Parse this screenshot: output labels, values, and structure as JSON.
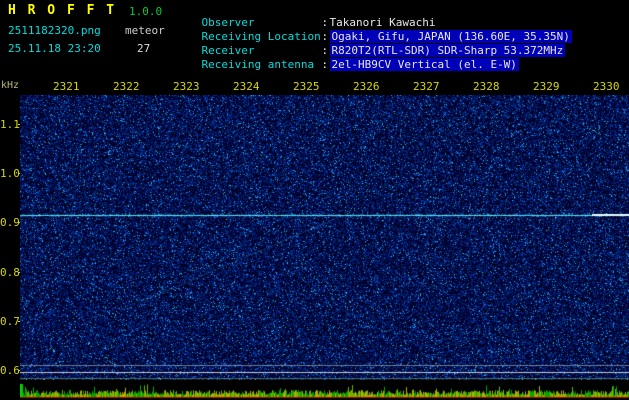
{
  "app": {
    "title": "H R O F F T",
    "version": "1.0.0",
    "filename": "2511182320.png",
    "mode": "meteor",
    "datetime": "25.11.18 23:20",
    "count": "27"
  },
  "info": {
    "colon": ":",
    "rows": [
      {
        "label": "Observer",
        "value": "Takanori Kawachi",
        "highlighted": false
      },
      {
        "label": "Receiving Location",
        "value": "Ogaki, Gifu, JAPAN (136.60E, 35.35N)",
        "highlighted": true
      },
      {
        "label": "Receiver",
        "value": "R820T2(RTL-SDR) SDR-Sharp 53.372MHz",
        "highlighted": true
      },
      {
        "label": "Receiving antenna",
        "value": "2el-HB9CV Vertical (el. E-W)",
        "highlighted": true
      }
    ]
  },
  "axes": {
    "y_unit": "kHz",
    "time_labels": [
      "2321",
      "2322",
      "2323",
      "2324",
      "2325",
      "2326",
      "2327",
      "2328",
      "2329",
      "2330"
    ],
    "freq_labels": [
      "1.1",
      "1.0",
      "0.9",
      "0.8",
      "0.7",
      "0.6"
    ]
  },
  "colors": {
    "title_yellow": "#ffff00",
    "version_green": "#00cc33",
    "cyan_label": "#00dddd",
    "value_text": "#e8e8e8",
    "value_highlight_bg": "#0000b8",
    "axis_label_yellow": "#d8d800",
    "carrier_cyan": "#55eeee",
    "meter_baseline_red": "#bb0000"
  },
  "chart_data": {
    "type": "heatmap",
    "title": "HROFFT radio meteor echo spectrogram 23:21-23:30",
    "x_ticks": [
      "2321",
      "2322",
      "2323",
      "2324",
      "2325",
      "2326",
      "2327",
      "2328",
      "2329",
      "2330"
    ],
    "y_ticks": [
      1.1,
      1.0,
      0.9,
      0.8,
      0.7,
      0.6
    ],
    "y_unit": "kHz",
    "ylim": [
      1.16,
      0.58
    ],
    "noise_floor": "dark blue speckle noise across entire plot",
    "carrier": {
      "freq_khz": 0.915,
      "color": "#55eeee",
      "note": "continuous horizontal direct-signal line across full width"
    },
    "bright_segment": {
      "freq_khz": 0.915,
      "x_frac_start": 0.94,
      "x_frac_end": 1.0,
      "color": "#e6ffff"
    },
    "horizontal_lines": [
      {
        "freq_khz": 0.61,
        "color": "#c8ccd0",
        "alpha": 0.55
      },
      {
        "freq_khz": 0.597,
        "color": "#dcdfe2",
        "alpha": 0.9
      },
      {
        "freq_khz": 0.585,
        "color": "#a0c850",
        "alpha": 0.5
      }
    ],
    "diagonal_streaks": [
      {
        "x0_frac": 0.2,
        "f0_khz": 0.74,
        "x1_frac": 0.54,
        "f1_khz": 0.92,
        "alpha": 0.25
      },
      {
        "x0_frac": 0.3,
        "f0_khz": 1.1,
        "x1_frac": 0.05,
        "f1_khz": 0.95,
        "alpha": 0.15
      }
    ],
    "level_meter": {
      "bar_colors": [
        "#b0b000",
        "#70b000",
        "#00a800"
      ],
      "baseline_color": "#bb0000",
      "description": "per-second signal level bars along the time axis"
    }
  }
}
